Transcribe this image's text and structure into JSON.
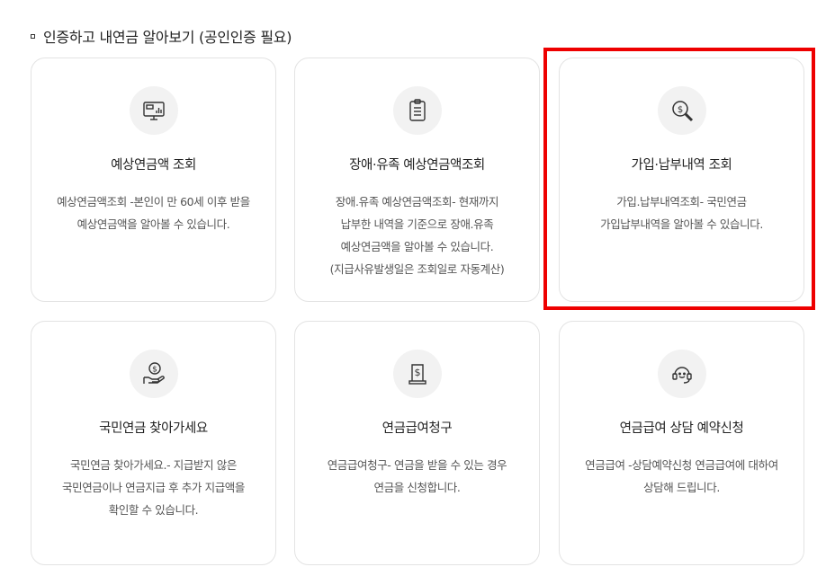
{
  "section": {
    "title": "인증하고 내연금 알아보기 (공인인증 필요)"
  },
  "cards": [
    {
      "icon": "monitor-chart-icon",
      "title": "예상연금액 조회",
      "desc": "예상연금액조회 -본인이 만 60세 이후 받을\n예상연금액을 알아볼 수 있습니다."
    },
    {
      "icon": "clipboard-icon",
      "title": "장애·유족 예상연금액조회",
      "desc": "장애.유족 예상연금액조회- 현재까지\n납부한 내역을 기준으로 장애.유족\n예상연금액을 알아볼 수 있습니다.\n(지급사유발생일은 조회일로 자동계산)"
    },
    {
      "icon": "dollar-search-icon",
      "title": "가입·납부내역 조회",
      "desc": "가입.납부내역조회- 국민연금\n가입납부내역을 알아볼 수 있습니다."
    },
    {
      "icon": "hand-coin-icon",
      "title": "국민연금 찾아가세요",
      "desc": "국민연금 찾아가세요.- 지급받지 않은\n국민연금이나 연금지급 후 추가 지급액을\n확인할 수 있습니다."
    },
    {
      "icon": "document-dollar-icon",
      "title": "연금급여청구",
      "desc": "연금급여청구- 연금을 받을 수 있는 경우\n연금을 신청합니다."
    },
    {
      "icon": "headset-icon",
      "title": "연금급여 상담 예약신청",
      "desc": "연금급여 -상담예약신청 연금급여에 대하여\n상담해 드립니다."
    }
  ],
  "colors": {
    "highlight": "#ee0000",
    "icon_bg": "#f2f2f2",
    "border": "#e3e3e3"
  }
}
